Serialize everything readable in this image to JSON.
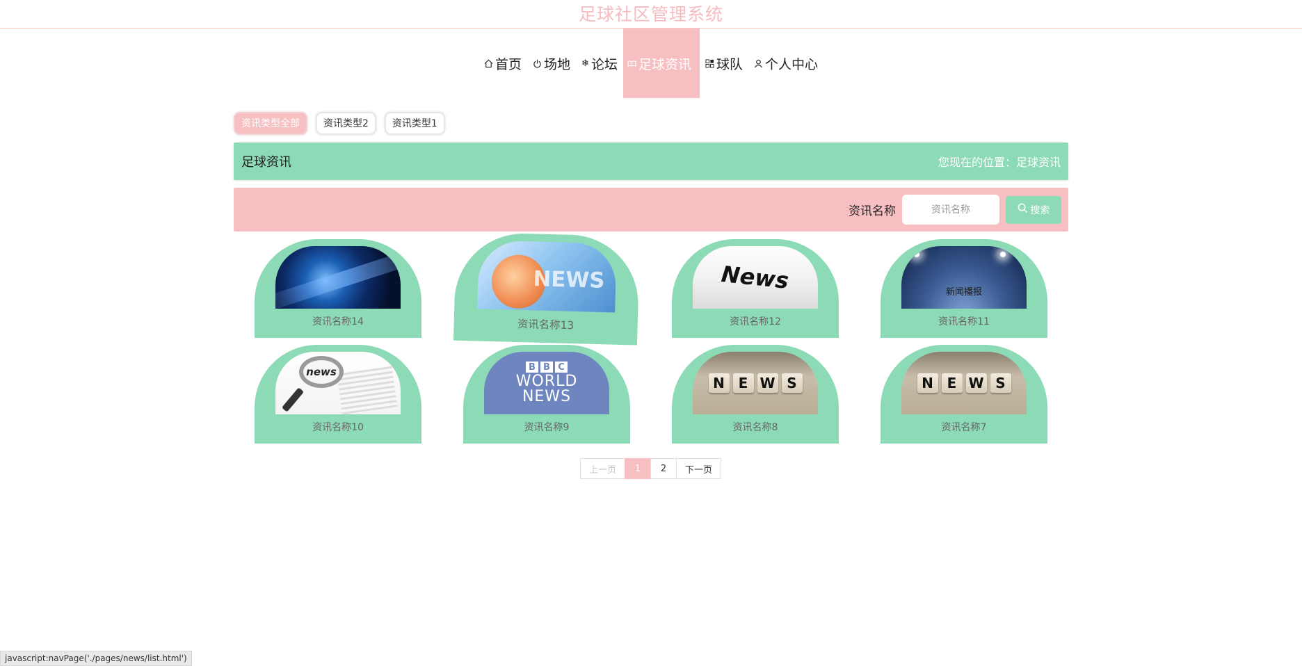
{
  "header": {
    "title": "足球社区管理系统"
  },
  "nav": {
    "items": [
      {
        "label": "首页",
        "icon": "home-icon"
      },
      {
        "label": "场地",
        "icon": "power-icon"
      },
      {
        "label": "论坛",
        "icon": "snowflake-icon"
      },
      {
        "label": "足球资讯",
        "icon": "book-icon",
        "active": true
      },
      {
        "label": "球队",
        "icon": "grid-icon"
      },
      {
        "label": "个人中心",
        "icon": "user-icon"
      }
    ]
  },
  "type_tabs": [
    "资讯类型全部",
    "资讯类型2",
    "资讯类型1"
  ],
  "section": {
    "title": "足球资讯",
    "breadcrumb": "您现在的位置：足球资讯"
  },
  "search": {
    "label": "资讯名称",
    "placeholder": "资讯名称",
    "button_label": "搜索"
  },
  "cards": [
    {
      "title": "资讯名称14"
    },
    {
      "title": "资讯名称13",
      "image_text": "NEWS"
    },
    {
      "title": "资讯名称12",
      "image_text": "News"
    },
    {
      "title": "资讯名称11",
      "image_text": "新闻播报"
    },
    {
      "title": "资讯名称10",
      "image_text": "news"
    },
    {
      "title": "资讯名称9",
      "image_text": "BBC WORLD NEWS"
    },
    {
      "title": "资讯名称8",
      "image_text": "NEWS"
    },
    {
      "title": "资讯名称7",
      "image_text": "NEWS"
    }
  ],
  "pagination": {
    "prev": "上一页",
    "pages": [
      "1",
      "2"
    ],
    "current": "1",
    "next": "下一页"
  },
  "status_bar": "javascript:navPage('./pages/news/list.html')",
  "colors": {
    "pink": "#f7bfc2",
    "green": "#8cdab6"
  }
}
